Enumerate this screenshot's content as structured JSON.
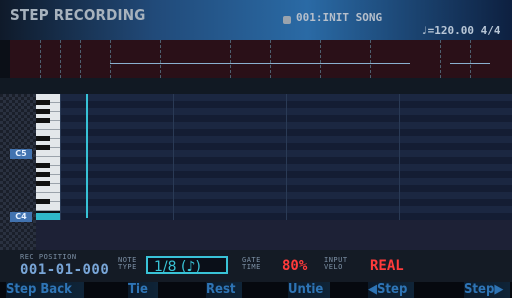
{
  "header": {
    "title": "STEP RECORDING",
    "song_name": "001:INIT SONG",
    "tempo": "♩=120.00  4/4"
  },
  "piano_roll": {
    "upper_octave_label": "C5",
    "lower_octave_label": "C4"
  },
  "parameters": {
    "rec_position_label": "REC POSITION",
    "rec_position_value": "001-01-000",
    "note_type_label": "NOTE TYPE",
    "note_type_value": "1/8 (♪)",
    "gate_time_label": "GATE TIME",
    "gate_time_value": "80%",
    "input_velo_label": "INPUT VELO",
    "input_velo_value": "REAL"
  },
  "function_buttons": {
    "step_back": "Step Back",
    "tie": "Tie",
    "rest": "Rest",
    "untie": "Untie",
    "step_left": "◀Step",
    "step_right": "Step▶"
  },
  "colors": {
    "accent": "#39c3d6",
    "alert": "#ff3b3b",
    "function_label": "#2e74b5"
  }
}
